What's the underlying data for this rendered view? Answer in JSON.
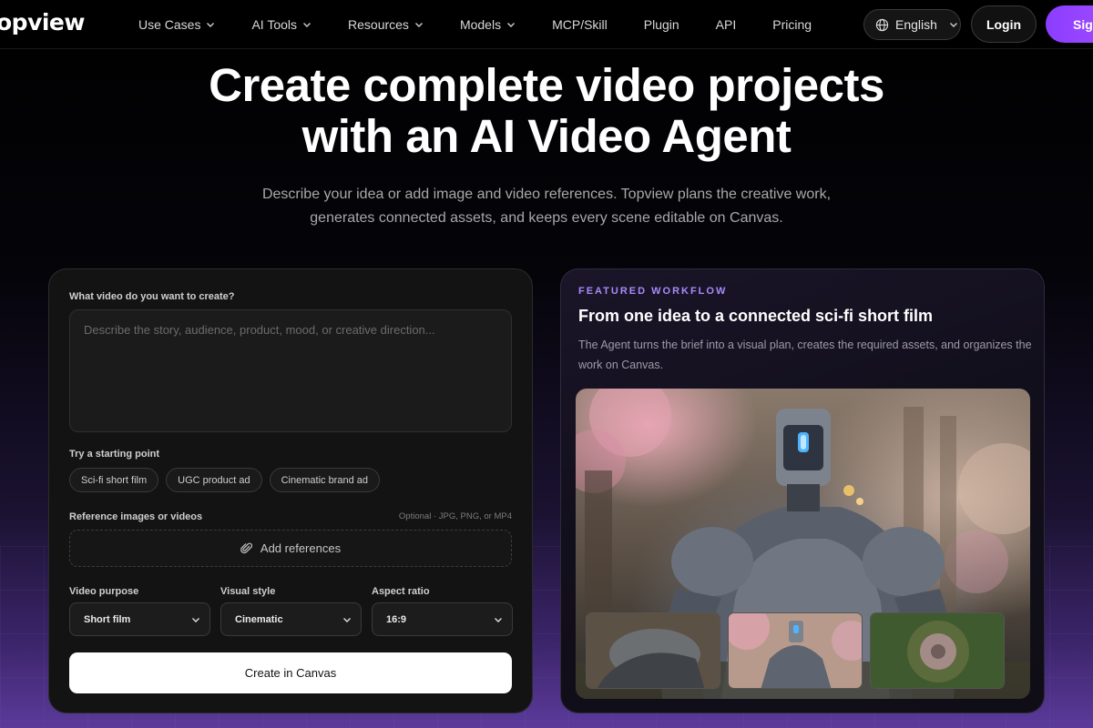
{
  "nav": {
    "logo": "opview",
    "items": [
      {
        "label": "Use Cases",
        "has_dropdown": true
      },
      {
        "label": "AI Tools",
        "has_dropdown": true
      },
      {
        "label": "Resources",
        "has_dropdown": true
      },
      {
        "label": "Models",
        "has_dropdown": true
      },
      {
        "label": "MCP/Skill",
        "has_dropdown": false
      },
      {
        "label": "Plugin",
        "has_dropdown": false
      },
      {
        "label": "API",
        "has_dropdown": false
      },
      {
        "label": "Pricing",
        "has_dropdown": false
      }
    ],
    "language": "English",
    "login": "Login",
    "signup": "Sig"
  },
  "hero": {
    "title_line1": "Create complete video projects",
    "title_line2": "with an AI Video Agent",
    "subtitle_line1": "Describe your idea or add image and video references. Topview plans the creative work,",
    "subtitle_line2": "generates connected assets, and keeps every scene editable on Canvas."
  },
  "form": {
    "prompt_label": "What video do you want to create?",
    "prompt_placeholder": "Describe the story, audience, product, mood, or creative direction...",
    "prompt_value": "",
    "starting_point_label": "Try a starting point",
    "chips": [
      "Sci-fi short film",
      "UGC product ad",
      "Cinematic brand ad"
    ],
    "references_label": "Reference images or videos",
    "references_hint": "Optional · JPG, PNG, or MP4",
    "add_references": "Add references",
    "purpose_label": "Video purpose",
    "purpose_value": "Short film",
    "style_label": "Visual style",
    "style_value": "Cinematic",
    "ratio_label": "Aspect ratio",
    "ratio_value": "16:9",
    "create_button": "Create in Canvas"
  },
  "featured": {
    "label": "FEATURED WORKFLOW",
    "title": "From one idea to a connected sci-fi short film",
    "description": "The Agent turns the brief into a visual plan, creates the required assets, and organizes the work on Canvas."
  },
  "colors": {
    "accent_purple": "#8b3dff",
    "featured_label": "#a78bfa",
    "background": "#000000"
  }
}
